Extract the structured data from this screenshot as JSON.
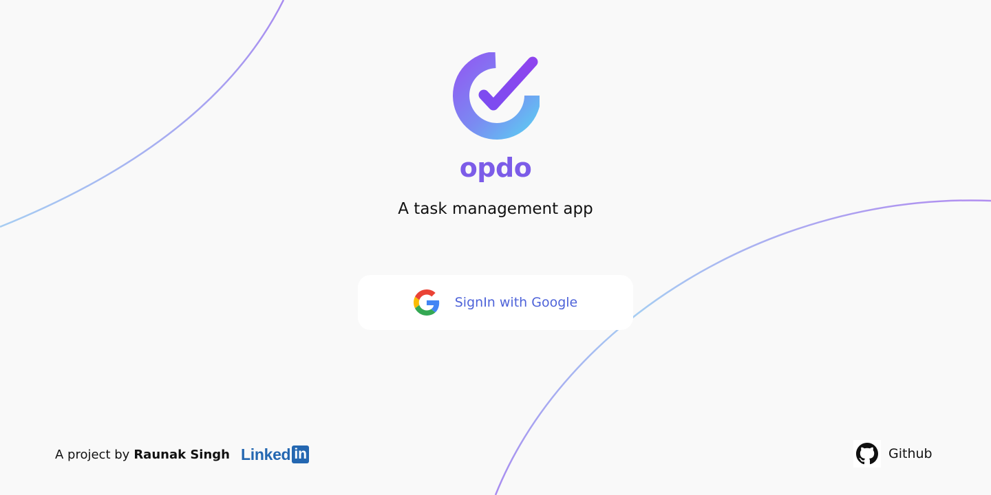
{
  "app": {
    "name": "opdo",
    "tagline": "A task management app"
  },
  "signin": {
    "label": "SignIn with Google",
    "icon": "google-icon"
  },
  "footer": {
    "credit_prefix": "A project by",
    "author": "Raunak Singh",
    "linkedin_word": "Linked",
    "linkedin_box": "in",
    "github_label": "Github"
  },
  "colors": {
    "background": "#f9f9f9",
    "brand": "#7c5ce8",
    "signin_text": "#4e63d9",
    "linkedin": "#2467b1",
    "arc_start": "#a6cdf2",
    "arc_end": "#a88bf0"
  }
}
